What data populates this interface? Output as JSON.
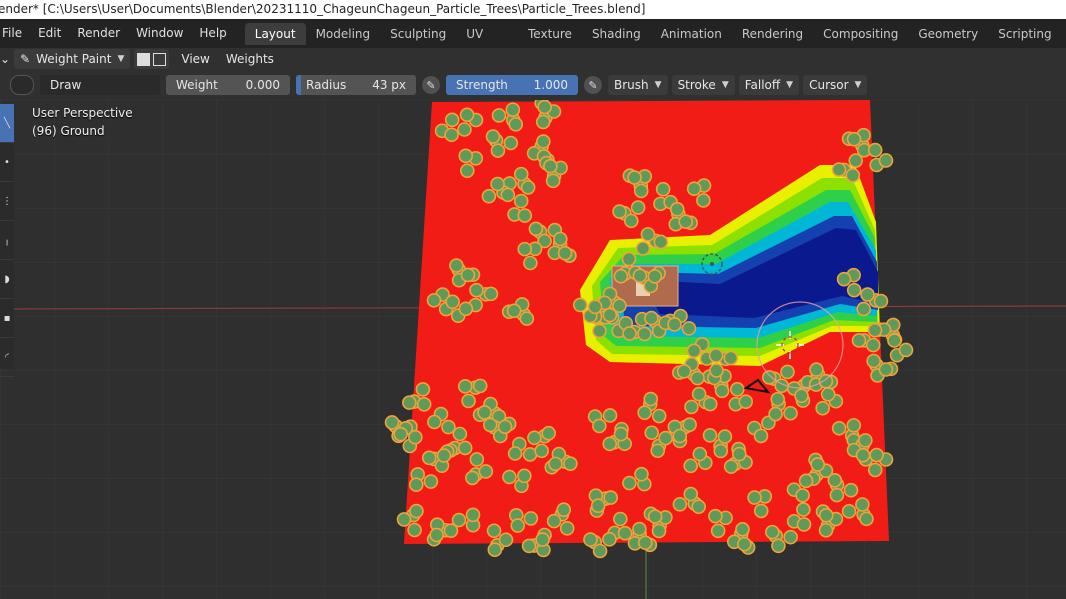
{
  "title_bar": {
    "text": "ender* [C:\\Users\\User\\Documents\\Blender\\20231110_ChageunChageun_Particle_Trees\\Particle_Trees.blend]"
  },
  "menu": [
    "File",
    "Edit",
    "Render",
    "Window",
    "Help"
  ],
  "workspaces": {
    "tabs": [
      "Layout",
      "Modeling",
      "Sculpting",
      "UV Editing",
      "Texture Paint",
      "Shading",
      "Animation",
      "Rendering",
      "Compositing",
      "Geometry Nodes",
      "Scripting"
    ],
    "active": "Layout",
    "add_label": "+"
  },
  "header": {
    "mode_label": "Weight Paint",
    "view_label": "View",
    "weights_label": "Weights"
  },
  "tool_settings": {
    "brush_name": "Draw",
    "weight_label": "Weight",
    "weight_value": "0.000",
    "radius_label": "Radius",
    "radius_value": "43 px",
    "strength_label": "Strength",
    "strength_value": "1.000",
    "brush_menu": "Brush",
    "stroke_menu": "Stroke",
    "falloff_menu": "Falloff",
    "cursor_menu": "Cursor"
  },
  "viewport": {
    "perspective_label": "User Perspective",
    "object_label": "(96) Ground"
  },
  "colors": {
    "weight_red": "#f21c16",
    "weight_yellow": "#e8f000",
    "weight_green": "#2ed04a",
    "weight_cyan": "#00b7d6",
    "weight_blue": "#0a1a8e",
    "tree_fill": "#5e9a5a",
    "tree_outline": "#f2a23a",
    "accent_blue": "#4772b3"
  }
}
